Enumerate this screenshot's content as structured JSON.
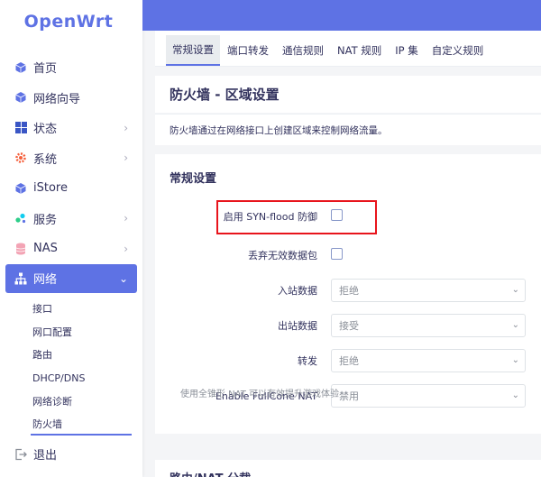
{
  "app": {
    "logo": "OpenWrt"
  },
  "sidebar": {
    "items": [
      {
        "label": "首页",
        "icon": "cube-icon"
      },
      {
        "label": "网络向导",
        "icon": "cube-icon"
      },
      {
        "label": "状态",
        "icon": "grid-icon",
        "chevron": true
      },
      {
        "label": "系统",
        "icon": "gear-icon",
        "chevron": true
      },
      {
        "label": "iStore",
        "icon": "cube-icon"
      },
      {
        "label": "服务",
        "icon": "puzzle-icon",
        "chevron": true
      },
      {
        "label": "NAS",
        "icon": "database-icon",
        "chevron": true
      },
      {
        "label": "网络",
        "icon": "network-icon",
        "chevron": true,
        "expanded": true
      }
    ],
    "sub_items": [
      {
        "label": "接口"
      },
      {
        "label": "网口配置"
      },
      {
        "label": "路由"
      },
      {
        "label": "DHCP/DNS"
      },
      {
        "label": "网络诊断"
      },
      {
        "label": "防火墙",
        "current": true
      }
    ],
    "logout": "退出"
  },
  "tabs": [
    {
      "label": "常规设置",
      "active": true
    },
    {
      "label": "端口转发"
    },
    {
      "label": "通信规则"
    },
    {
      "label": "NAT 规则"
    },
    {
      "label": "IP 集"
    },
    {
      "label": "自定义规则"
    }
  ],
  "page": {
    "title": "防火墙 - 区域设置",
    "description": "防火墙通过在网络接口上创建区域来控制网络流量。"
  },
  "general": {
    "section_title": "常规设置",
    "syn_flood_label": "启用 SYN-flood 防御",
    "syn_flood_checked": false,
    "drop_invalid_label": "丢弃无效数据包",
    "drop_invalid_checked": false,
    "input_label": "入站数据",
    "input_value": "拒绝",
    "output_label": "出站数据",
    "output_value": "接受",
    "forward_label": "转发",
    "forward_value": "拒绝",
    "fullcone_label": "Enable FullCone NAT",
    "fullcone_value": "禁用",
    "fullcone_help": "使用全锥形 NAT 可以有效提升游戏体验"
  },
  "next_section_title": "路由/NAT 分载",
  "colors": {
    "accent": "#5e72e4",
    "highlight": "#e8141c"
  }
}
